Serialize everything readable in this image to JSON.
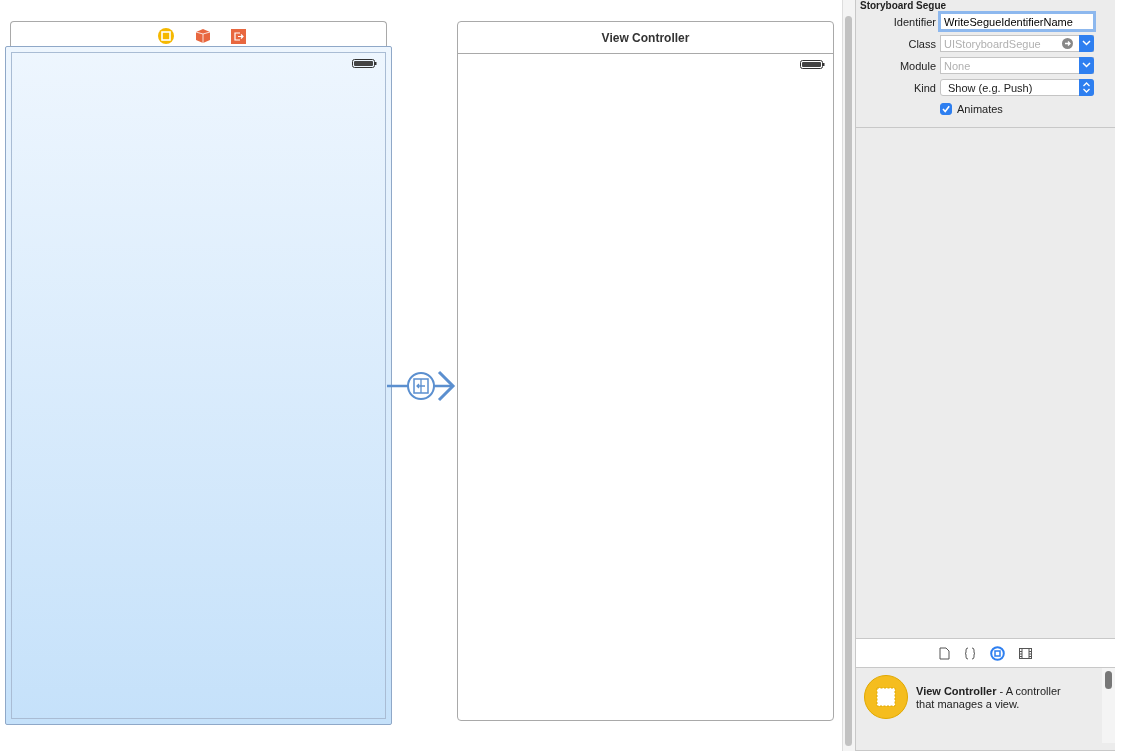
{
  "canvas": {
    "scenes": [
      {
        "kind": "selected",
        "dock_icons": [
          {
            "kind": "circle"
          },
          {
            "kind": "cube"
          },
          {
            "kind": "exit"
          }
        ]
      },
      {
        "kind": "plain",
        "title": "View Controller"
      }
    ]
  },
  "inspector": {
    "section_title": "Storyboard Segue",
    "fields": [
      {
        "label": "Identifier",
        "kind": "text",
        "value": "WriteSegueIdentifierName",
        "focused": true
      },
      {
        "label": "Class",
        "kind": "combo",
        "placeholder": "UIStoryboardSegue",
        "focused": false
      },
      {
        "label": "Module",
        "kind": "combo",
        "placeholder": "None",
        "focused": false
      },
      {
        "label": "Kind",
        "kind": "popup",
        "value": "Show (e.g. Push)",
        "focused": false
      }
    ],
    "animates": {
      "label": "Animates",
      "checked": true
    },
    "library_tabs": [
      {
        "kind": "file",
        "selected": false
      },
      {
        "kind": "braces",
        "selected": false
      },
      {
        "kind": "circle",
        "selected": true
      },
      {
        "kind": "film",
        "selected": false
      }
    ],
    "library_items": [
      {
        "text": "**View Controller** - A controller that manages a view."
      }
    ]
  }
}
